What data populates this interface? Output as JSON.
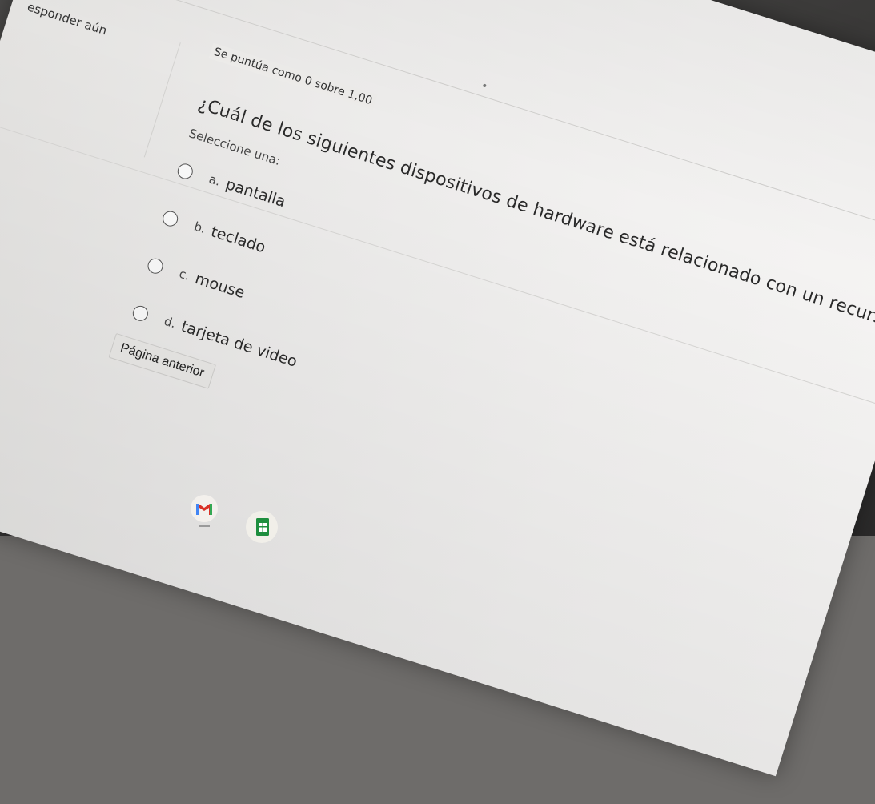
{
  "quiz": {
    "state_label": "esponder aún",
    "grade_label": "Se puntúa como 0 sobre 1,00",
    "question_text": "¿Cuál de los siguientes dispositivos de hardware está relacionado con un recurso multimedia?",
    "select_label": "Seleccione una:",
    "options": [
      {
        "letter": "a.",
        "text": "pantalla"
      },
      {
        "letter": "b.",
        "text": "teclado"
      },
      {
        "letter": "c.",
        "text": "mouse"
      },
      {
        "letter": "d.",
        "text": "tarjeta de video"
      }
    ],
    "prev_page_label": "Página anterior"
  },
  "taskbar": {
    "icons": [
      "gmail-icon",
      "sheets-icon"
    ]
  },
  "colors": {
    "screen_bg": "#efeeec",
    "text": "#2a2a2a",
    "gmail_red": "#d93025",
    "sheets_green": "#1e8e3e"
  }
}
